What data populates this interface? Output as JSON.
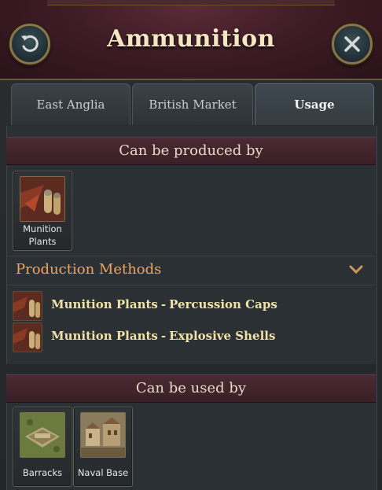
{
  "header": {
    "title": "Ammunition"
  },
  "tabs": [
    {
      "label": "East Anglia"
    },
    {
      "label": "British Market"
    },
    {
      "label": "Usage"
    }
  ],
  "produced_by": {
    "title": "Can be produced by",
    "buildings": [
      {
        "label_line1": "Munition",
        "label_line2": "Plants",
        "icon": "munition-plants-icon"
      }
    ]
  },
  "production_methods": {
    "title": "Production Methods",
    "items": [
      {
        "building": "Munition Plants",
        "separator": "-",
        "method": "Percussion Caps",
        "icon": "munition-plants-icon"
      },
      {
        "building": "Munition Plants",
        "separator": "-",
        "method": "Explosive Shells",
        "icon": "munition-plants-icon"
      }
    ]
  },
  "used_by": {
    "title": "Can be used by",
    "buildings": [
      {
        "label": "Barracks",
        "icon": "barracks-icon"
      },
      {
        "label": "Naval Base",
        "icon": "naval-base-icon"
      }
    ]
  },
  "colors": {
    "accent_orange": "#f0a45a",
    "method_text": "#f1e3a8",
    "title_text": "#f4e6c2"
  }
}
